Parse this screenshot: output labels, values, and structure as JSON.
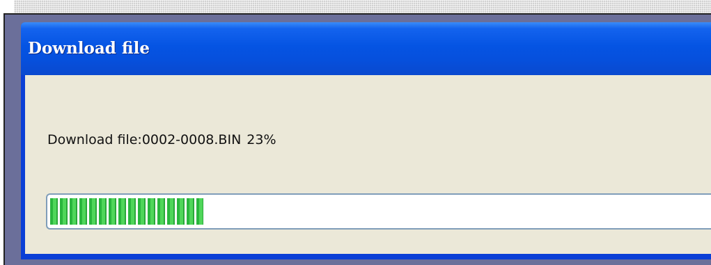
{
  "window": {
    "title": "Download file"
  },
  "download": {
    "label": "Download file:",
    "filename": "0002-0008.BIN",
    "percent_text": "23%"
  },
  "progress": {
    "value_percent": 23,
    "fill_color": "#3cc848"
  },
  "colors": {
    "titlebar": "#0554e3",
    "client_background": "#ebe8d8",
    "desktop": "#6b6f9a"
  }
}
